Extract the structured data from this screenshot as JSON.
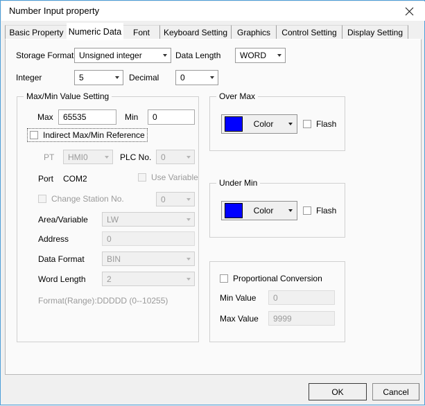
{
  "window": {
    "title": "Number Input property",
    "close_icon": "close-icon"
  },
  "tabs": [
    {
      "label": "Basic Property",
      "selected": false
    },
    {
      "label": "Numeric Data",
      "selected": true
    },
    {
      "label": "Font",
      "selected": false
    },
    {
      "label": "Keyboard Setting",
      "selected": false
    },
    {
      "label": "Graphics",
      "selected": false
    },
    {
      "label": "Control Setting",
      "selected": false
    },
    {
      "label": "Display Setting",
      "selected": false
    }
  ],
  "format_row": {
    "storage_format_label": "Storage Format",
    "storage_format_value": "Unsigned integer",
    "data_length_label": "Data Length",
    "data_length_value": "WORD",
    "integer_label": "Integer",
    "integer_value": "5",
    "decimal_label": "Decimal",
    "decimal_value": "0"
  },
  "maxmin": {
    "group_title": "Max/Min Value Setting",
    "max_label": "Max",
    "max_value": "65535",
    "min_label": "Min",
    "min_value": "0",
    "indirect_label": "Indirect Max/Min Reference",
    "pt_label": "PT",
    "pt_value": "HMI0",
    "plcno_label": "PLC No.",
    "plcno_value": "0",
    "port_label": "Port",
    "port_value": "COM2",
    "use_variable_label": "Use Variable",
    "change_station_label": "Change Station No.",
    "station_value": "0",
    "area_label": "Area/Variable",
    "area_value": "LW",
    "address_label": "Address",
    "address_value": "0",
    "data_format_label": "Data Format",
    "data_format_value": "BIN",
    "word_length_label": "Word Length",
    "word_length_value": "2",
    "format_range": "Format(Range):DDDDD (0--10255)"
  },
  "over_max": {
    "group_title": "Over Max",
    "color_label": "Color",
    "color_value": "#0000FF",
    "flash_label": "Flash"
  },
  "under_min": {
    "group_title": "Under Min",
    "color_label": "Color",
    "color_value": "#0000FF",
    "flash_label": "Flash"
  },
  "proportional": {
    "checkbox_label": "Proportional Conversion",
    "min_label": "Min Value",
    "min_value": "0",
    "max_label": "Max Value",
    "max_value": "9999"
  },
  "footer": {
    "ok_label": "OK",
    "cancel_label": "Cancel"
  }
}
